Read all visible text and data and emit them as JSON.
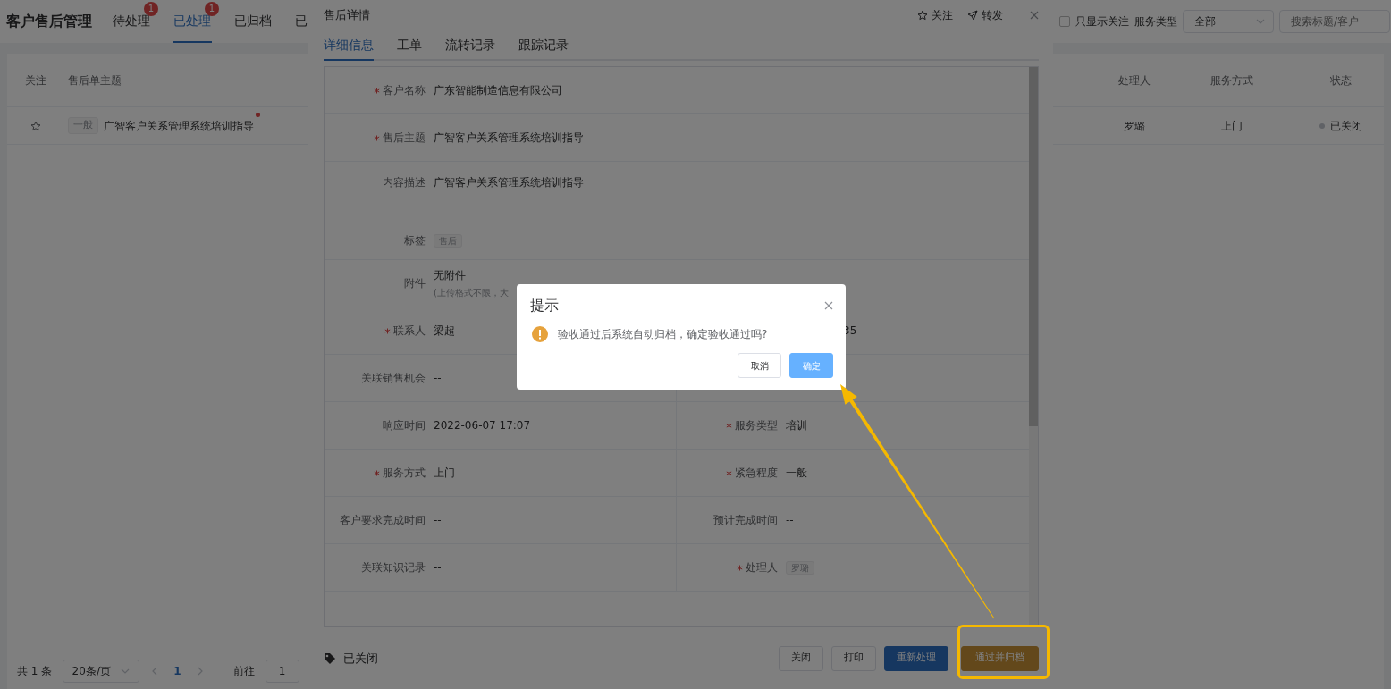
{
  "header": {
    "title": "客户售后管理",
    "tabs": [
      {
        "label": "待处理",
        "badge": "1",
        "selected": false
      },
      {
        "label": "已处理",
        "badge": "1",
        "selected": true
      },
      {
        "label": "已归档",
        "selected": false
      },
      {
        "label": "已",
        "selected": false
      }
    ],
    "only_followed": {
      "label": "只显示关注",
      "checked": false
    },
    "service_type": {
      "label": "服务类型",
      "value": "全部"
    },
    "search": {
      "placeholder": "搜索标题/客户"
    }
  },
  "table": {
    "columns": [
      {
        "label": "关注",
        "kind": "follow"
      },
      {
        "label": "售后单主题",
        "kind": "subject"
      },
      {
        "label": "处理人",
        "kind": "handler"
      },
      {
        "label": "服务方式",
        "kind": "mode"
      },
      {
        "label": "状态",
        "kind": "status"
      }
    ],
    "rows": [
      {
        "followed": false,
        "level": "一般",
        "subject": "广智客户关系管理系统培训指导",
        "unread": true,
        "handler": "罗璐",
        "mode": "上门",
        "status": "已关闭"
      }
    ]
  },
  "pagination": {
    "total": "共 1 条",
    "page_size": "20条/页",
    "pages": [
      {
        "label": "1",
        "selected": true
      }
    ],
    "goto_label": "前往",
    "goto_value": "1"
  },
  "drawer": {
    "title": "售后详情",
    "actions": [
      {
        "label": "关注"
      },
      {
        "label": "转发"
      }
    ],
    "tabs": [
      {
        "label": "详细信息",
        "selected": true
      },
      {
        "label": "工单",
        "selected": false
      },
      {
        "label": "流转记录",
        "selected": false
      },
      {
        "label": "跟踪记录",
        "selected": false
      }
    ],
    "rows": [
      {
        "kind": "full",
        "cells": [
          {
            "label": "客户名称",
            "required": true,
            "value": "广东智能制造信息有限公司"
          }
        ]
      },
      {
        "kind": "full",
        "cells": [
          {
            "label": "售后主题",
            "required": true,
            "value": "广智客户关系管理系统培训指导"
          }
        ]
      },
      {
        "kind": "block",
        "cells": [
          {
            "label": "内容描述",
            "required": false,
            "value": "广智客户关系管理系统培训指导"
          }
        ]
      },
      {
        "kind": "tags",
        "cells": [
          {
            "label": "标签",
            "required": false,
            "tags": [
              "售后"
            ]
          }
        ]
      },
      {
        "kind": "full",
        "cells": [
          {
            "label": "附件",
            "required": false,
            "value": "无附件",
            "hint": "(上传格式不限，大"
          }
        ]
      },
      {
        "kind": "pair",
        "cells": [
          {
            "label": "联系人",
            "required": true,
            "value": "梁超"
          },
          {
            "value": "35"
          }
        ]
      },
      {
        "kind": "pair",
        "cells": [
          {
            "label": "关联销售机会",
            "required": false,
            "value": "--"
          }
        ]
      },
      {
        "kind": "pair",
        "cells": [
          {
            "label": "响应时间",
            "required": false,
            "value": "2022-06-07 17:07"
          },
          {
            "label": "服务类型",
            "required": true,
            "value": "培训"
          }
        ]
      },
      {
        "kind": "pair",
        "cells": [
          {
            "label": "服务方式",
            "required": true,
            "value": "上门"
          },
          {
            "label": "紧急程度",
            "required": true,
            "value": "一般"
          }
        ]
      },
      {
        "kind": "pair",
        "cells": [
          {
            "label": "客户要求完成时间",
            "required": false,
            "value": "--"
          },
          {
            "label": "预计完成时间",
            "required": false,
            "value": "--"
          }
        ]
      },
      {
        "kind": "pair",
        "cells": [
          {
            "label": "关联知识记录",
            "required": false,
            "value": "--"
          },
          {
            "label": "处理人",
            "required": true,
            "tags": [
              "罗璐"
            ]
          }
        ]
      }
    ],
    "status": "已关闭",
    "buttons": [
      {
        "label": "关闭",
        "kind": "default"
      },
      {
        "label": "打印",
        "kind": "default"
      },
      {
        "label": "重新处理",
        "kind": "primary"
      },
      {
        "label": "通过并归档",
        "kind": "warning"
      }
    ]
  },
  "dialog": {
    "title": "提示",
    "message": "验收通过后系统自动归档，确定验收通过吗?",
    "buttons": [
      {
        "label": "取消",
        "kind": "default"
      },
      {
        "label": "确定",
        "kind": "primary"
      }
    ]
  }
}
